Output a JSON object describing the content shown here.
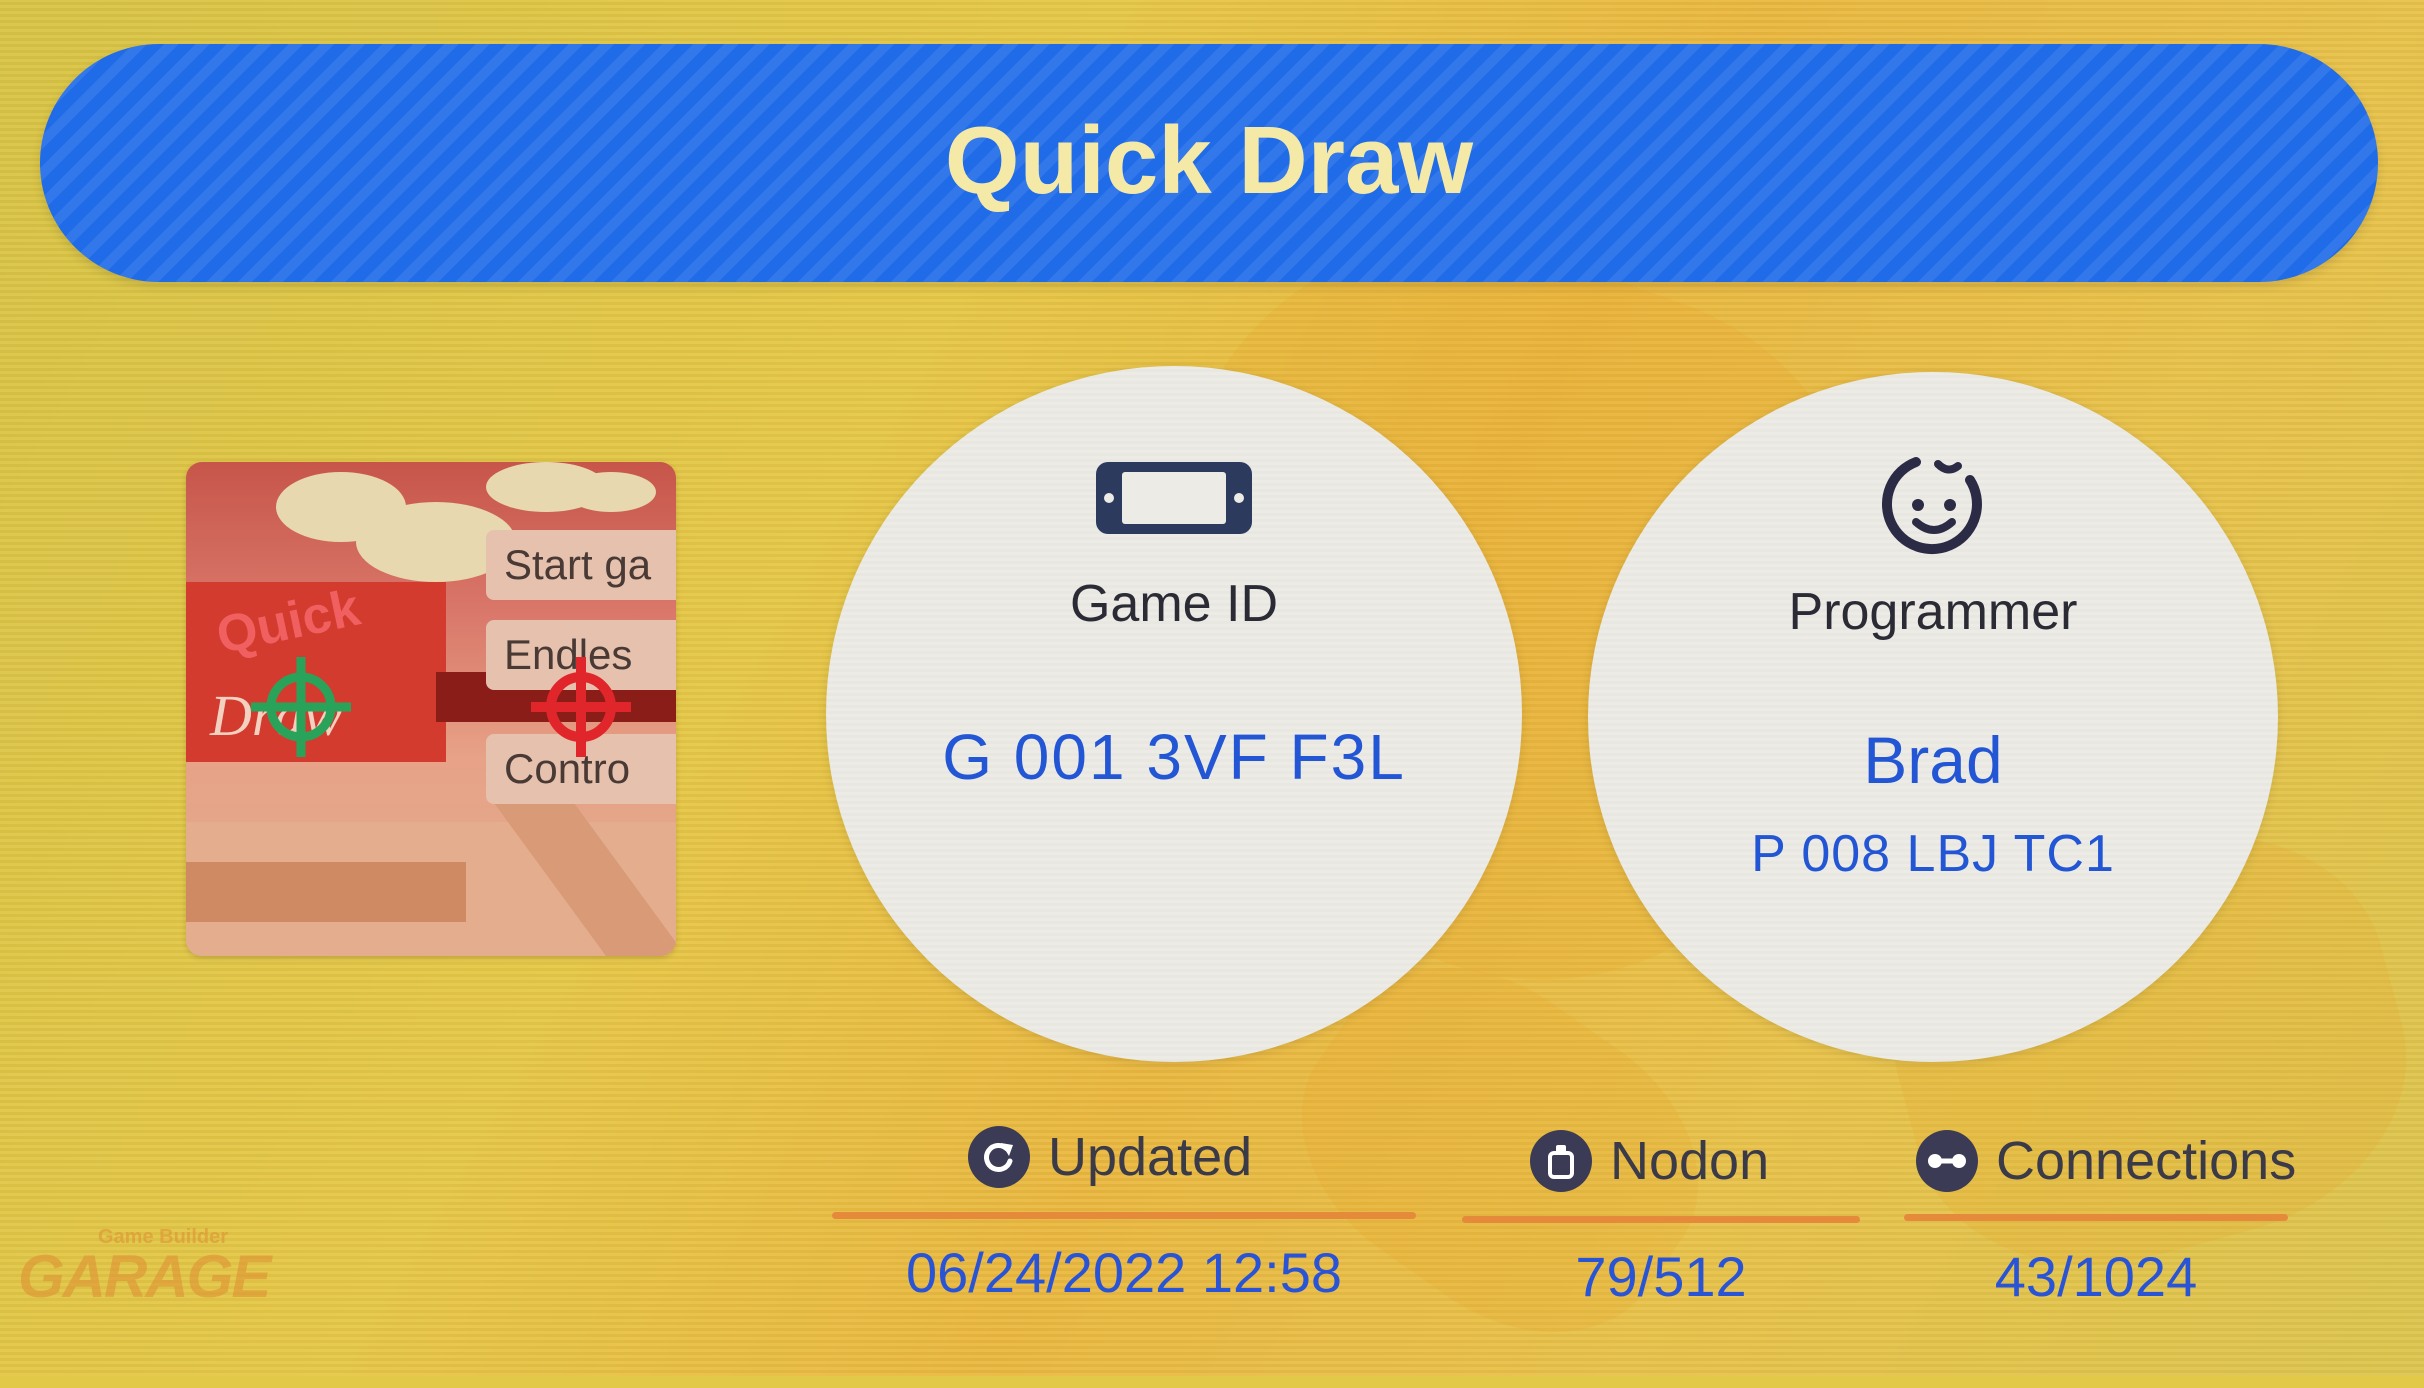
{
  "title": "Quick Draw",
  "thumbnail": {
    "title_line1": "Quick",
    "title_line2": "Draw",
    "menu": [
      "Start ga",
      "Endles",
      "Contro"
    ]
  },
  "game_id": {
    "label": "Game ID",
    "value": "G 001 3VF F3L",
    "icon": "console-icon"
  },
  "programmer": {
    "label": "Programmer",
    "name": "Brad",
    "id": "P 008 LBJ TC1",
    "icon": "face-icon"
  },
  "stats": {
    "updated": {
      "label": "Updated",
      "value": "06/24/2022 12:58",
      "icon": "refresh-icon"
    },
    "nodon": {
      "label": "Nodon",
      "value": "79/512",
      "icon": "nodon-icon"
    },
    "connections": {
      "label": "Connections",
      "value": "43/1024",
      "icon": "connection-icon"
    }
  },
  "logo": {
    "line1": "Game Builder",
    "line2": "GARAGE"
  },
  "colors": {
    "title_bar": "#1f6be8",
    "title_text": "#f4e9a6",
    "value_blue": "#2256d4",
    "underline": "#e58a3a",
    "background": "#e2c948"
  }
}
